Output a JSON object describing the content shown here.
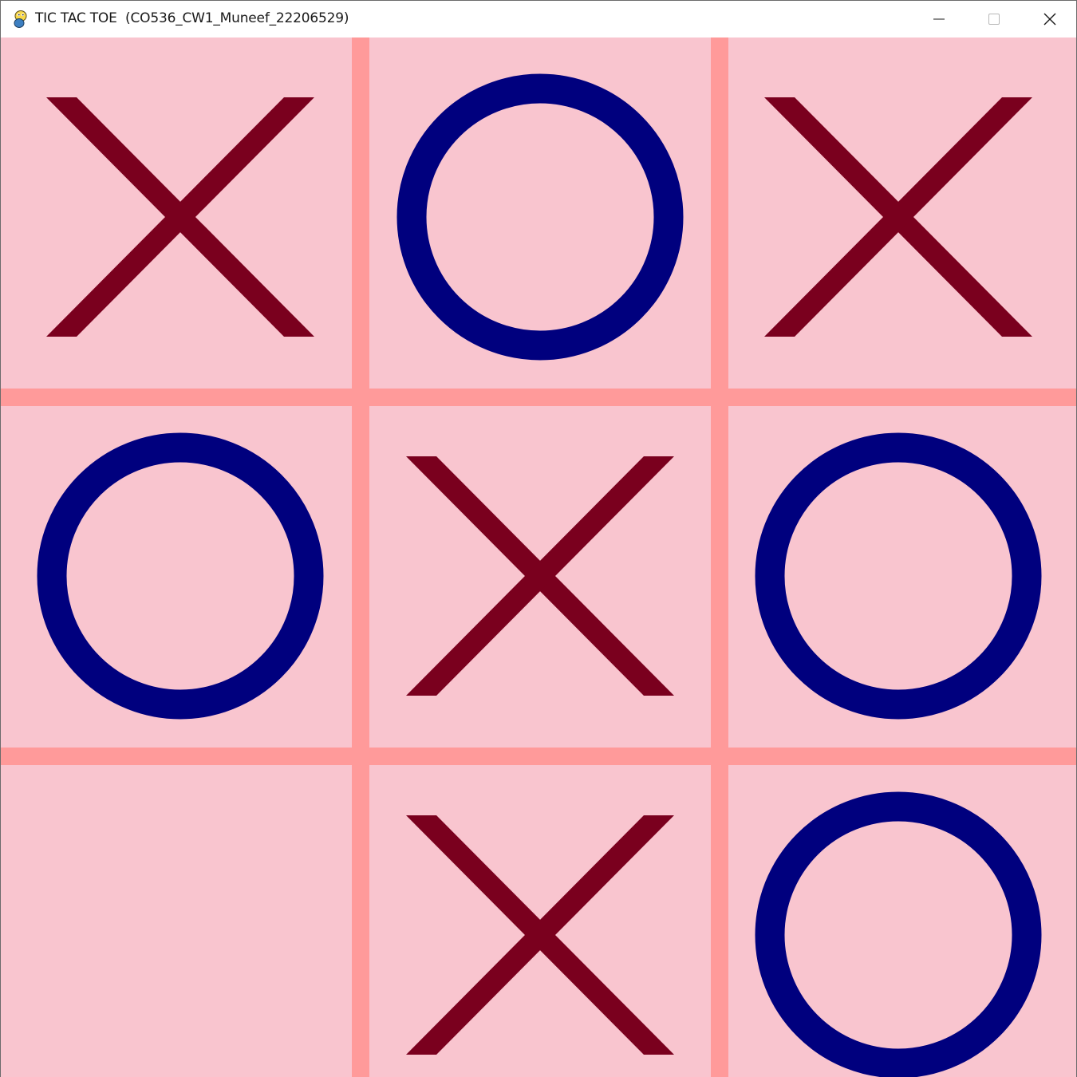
{
  "window": {
    "title": "TIC TAC TOE  (CO536_CW1_Muneef_22206529)",
    "app_icon": "python-snake-icon",
    "controls": {
      "minimize_icon": "minimize-icon",
      "maximize_icon": "maximize-icon",
      "close_icon": "close-icon"
    }
  },
  "colors": {
    "board_background": "#f9c5cf",
    "grid_lines": "#ff9a9a",
    "x_mark": "#7a001e",
    "o_mark": "#00007e",
    "titlebar": "#ffffff"
  },
  "game": {
    "board": [
      [
        "X",
        "O",
        "X"
      ],
      [
        "O",
        "X",
        "O"
      ],
      [
        "",
        "X",
        "O"
      ]
    ]
  }
}
